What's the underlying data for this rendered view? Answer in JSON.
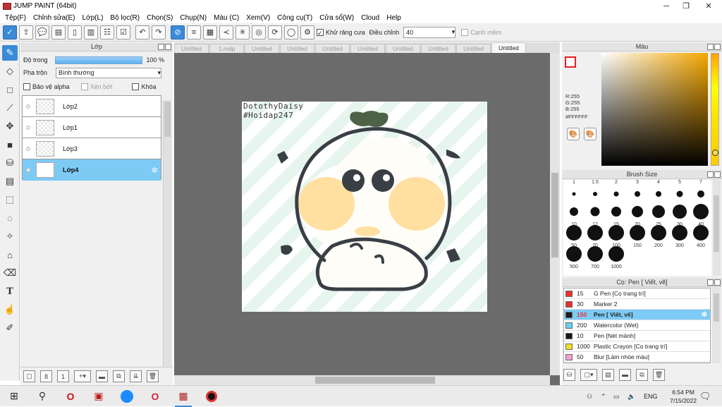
{
  "window": {
    "title": "JUMP PAINT (64bit)",
    "controls": [
      "─",
      "❐",
      "✕"
    ]
  },
  "menu": [
    "Tệp(F)",
    "Chỉnh sửa(E)",
    "Lớp(L)",
    "Bộ lọc(R)",
    "Chọn(S)",
    "Chụp(N)",
    "Màu (C)",
    "Xem(V)",
    "Công cụ(T)",
    "Cửa sổ(W)",
    "Cloud",
    "Help"
  ],
  "toolbar": {
    "antialias_label": "Khử răng cưa",
    "adjust_label": "Điều chỉnh",
    "adjust_value": "40",
    "snap_label": "Cạnh mềm"
  },
  "layers": {
    "title": "Lớp",
    "opacity_label": "Độ trong",
    "opacity_value": "100 %",
    "opacity_fraction": 1.0,
    "blend_label": "Pha trộn",
    "blend_value": "Bình thường",
    "protect_alpha": "Bảo vệ alpha",
    "clip": "Xén bớt",
    "lock": "Khóa",
    "items": [
      {
        "name": "Lớp2",
        "selected": false
      },
      {
        "name": "Lớp1",
        "selected": false
      },
      {
        "name": "Lớp3",
        "selected": false
      },
      {
        "name": "Lớp4",
        "selected": true
      }
    ]
  },
  "tabs": [
    {
      "label": "Untitled",
      "selected": false
    },
    {
      "label": "1.mdp",
      "selected": false
    },
    {
      "label": "Untitled",
      "selected": false
    },
    {
      "label": "Untitled",
      "selected": false
    },
    {
      "label": "Untitled",
      "selected": false
    },
    {
      "label": "Untitled",
      "selected": false
    },
    {
      "label": "Untitled",
      "selected": false
    },
    {
      "label": "Untitled",
      "selected": false
    },
    {
      "label": "Untitled",
      "selected": false
    },
    {
      "label": "Untitled",
      "selected": true
    }
  ],
  "canvas": {
    "text_line1": "DotothyDaisy",
    "text_line2": "#Hoidap247"
  },
  "color": {
    "title": "Màu",
    "r": "R:255",
    "g": "G:255",
    "b": "B:255",
    "hex": "#FFFFFF"
  },
  "brush_size": {
    "title": "Brush Size",
    "sizes": [
      "1",
      "1.5",
      "2",
      "3",
      "4",
      "5",
      "7",
      "10",
      "12",
      "15",
      "20",
      "25",
      "30",
      "40",
      "50",
      "70",
      "100",
      "150",
      "200",
      "300",
      "400",
      "500",
      "700",
      "1000"
    ]
  },
  "presets": {
    "title": "Cọ: Pen [ Viết, vẽ]",
    "items": [
      {
        "size": "15",
        "name": "G Pen [Cọ trang trí]",
        "color": "#e83030",
        "selected": false
      },
      {
        "size": "30",
        "name": "Marker 2",
        "color": "#e83030",
        "selected": false
      },
      {
        "size": "150",
        "name": "Pen [ Viết, vẽ]",
        "color": "#1a1a1a",
        "selected": true
      },
      {
        "size": "200",
        "name": "Watercolor (Wet)",
        "color": "#6ad0f0",
        "selected": false
      },
      {
        "size": "10",
        "name": "Pen [Nét mảnh]",
        "color": "#1a1a1a",
        "selected": false
      },
      {
        "size": "1000",
        "name": "Plastic Crayon [Cọ trang trí]",
        "color": "#f0e020",
        "selected": false
      },
      {
        "size": "50",
        "name": "Blur [Làm nhòe màu]",
        "color": "#f0a0d0",
        "selected": false
      }
    ]
  },
  "taskbar": {
    "language": "ENG",
    "time": "6:54 PM",
    "date": "7/15/2022"
  }
}
